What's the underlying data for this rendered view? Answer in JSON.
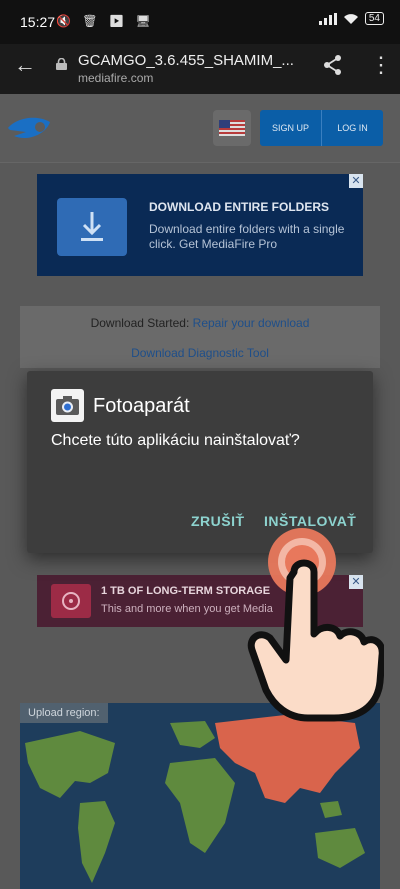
{
  "status_bar": {
    "time": "15:27",
    "battery": "54"
  },
  "browser": {
    "page_title": "GCAMGO_3.6.455_SHAMIM_...",
    "domain": "mediafire.com"
  },
  "site": {
    "signup_label": "SIGN UP",
    "login_label": "LOG IN"
  },
  "ad_top": {
    "title": "DOWNLOAD ENTIRE FOLDERS",
    "body": "Download entire folders with a single click. Get MediaFire Pro",
    "close": "✕"
  },
  "download": {
    "started_text": "Download Started:",
    "repair_link": "Repair your download",
    "diagnostic_link": "Download Diagnostic Tool"
  },
  "dialog": {
    "app_name": "Fotoaparát",
    "message": "Chcete túto aplikáciu nainštalovať?",
    "cancel_label": "ZRUŠIŤ",
    "install_label": "INŠTALOVAŤ"
  },
  "ad_bottom": {
    "title": "1 TB OF LONG-TERM STORAGE",
    "body": "This and more when you get Media",
    "close": "✕"
  },
  "map": {
    "label": "Upload region:"
  },
  "colors": {
    "accent_button": "#8dd3cf",
    "mediafire_blue": "#0b5ea7",
    "highlight_region": "#d9644c"
  }
}
